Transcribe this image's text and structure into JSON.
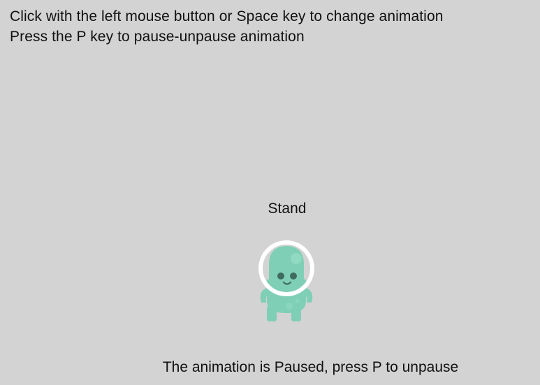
{
  "instructions": {
    "line1": "Click with the left mouse button or Space key to change animation",
    "line2": "Press the P key to pause-unpause animation"
  },
  "animation": {
    "name": "Stand",
    "state": "paused"
  },
  "status": "The animation is Paused, press P to unpause",
  "colors": {
    "background": "#d3d3d3",
    "text": "#111111",
    "character_body": "#7fcfb6",
    "character_shade": "#6bbfa4",
    "character_eyes": "#3f6b5d",
    "helmet_ring": "#ffffff"
  }
}
